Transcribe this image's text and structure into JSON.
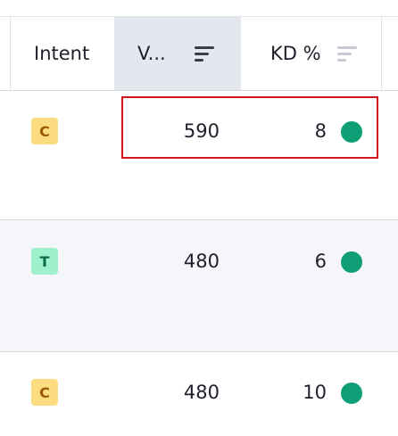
{
  "header": {
    "intent_label": "Intent",
    "volume_label": "V...",
    "kd_label": "KD %",
    "volume_sort_icon": "sort-descending-icon",
    "kd_sort_icon": "sort-descending-icon"
  },
  "rows": [
    {
      "intent": "C",
      "volume": "590",
      "kd": "8",
      "kd_color": "#0e9f76"
    },
    {
      "intent": "T",
      "volume": "480",
      "kd": "6",
      "kd_color": "#0e9f76"
    },
    {
      "intent": "C",
      "volume": "480",
      "kd": "10",
      "kd_color": "#0e9f76"
    }
  ],
  "colors": {
    "highlight_border": "#d0141b",
    "commercial_badge": "#fcdc80",
    "transactional_badge": "#9ff0cd",
    "sorted_header_bg": "#e5e7ef"
  }
}
